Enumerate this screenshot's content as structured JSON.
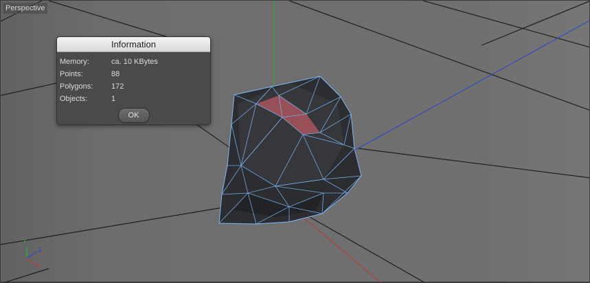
{
  "viewport": {
    "label": "Perspective"
  },
  "dialog": {
    "title": "Information",
    "rows": [
      {
        "label": "Memory:",
        "value": "ca. 10 KBytes"
      },
      {
        "label": "Points:",
        "value": "88"
      },
      {
        "label": "Polygons:",
        "value": "172"
      },
      {
        "label": "Objects:",
        "value": "1"
      }
    ],
    "ok_label": "OK"
  },
  "gizmo": {
    "y": "Y",
    "z": "Z",
    "x": "X"
  },
  "colors": {
    "y_axis": "#2fae2f",
    "x_axis": "#c03a32",
    "z_axis": "#2b45c8",
    "wire": "#7fb6f5"
  }
}
